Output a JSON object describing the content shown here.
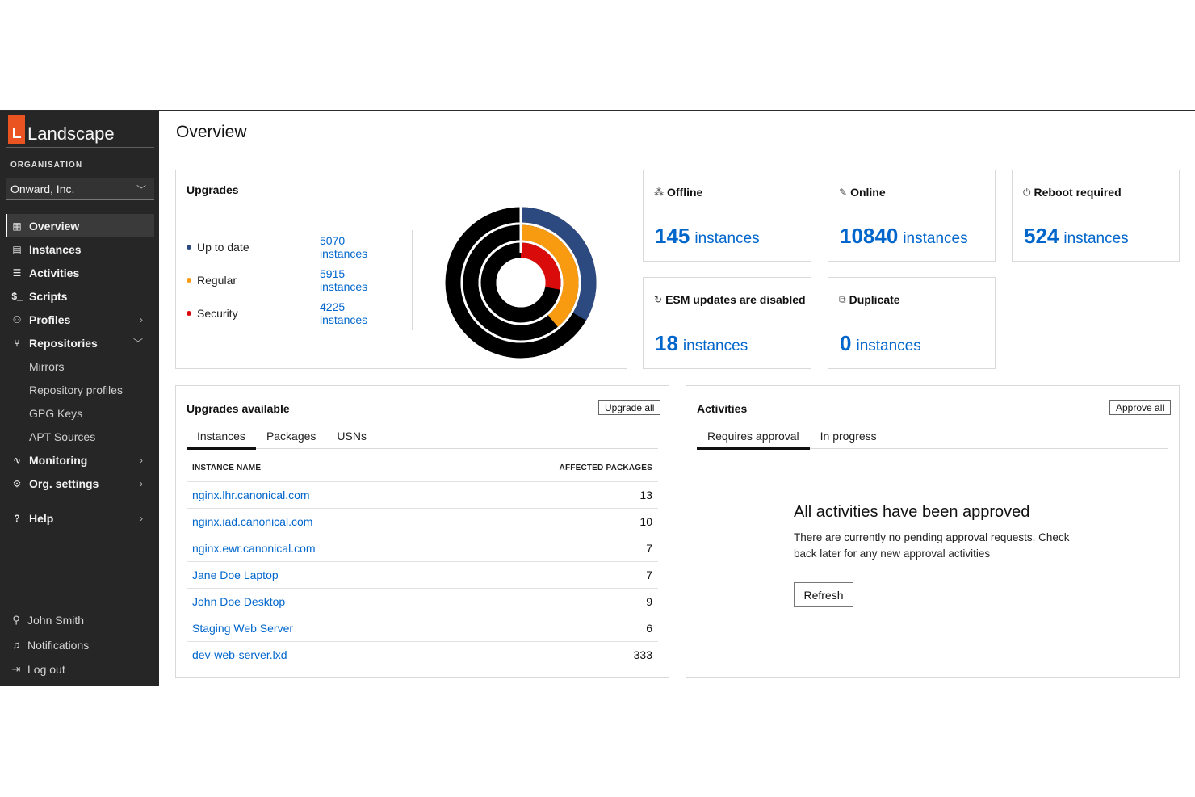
{
  "app": {
    "name": "Landscape"
  },
  "sidebar": {
    "org_label": "ORGANISATION",
    "org_value": "Onward, Inc.",
    "items": [
      {
        "label": "Overview",
        "icon": "grid-icon"
      },
      {
        "label": "Instances",
        "icon": "server-icon"
      },
      {
        "label": "Activities",
        "icon": "list-icon"
      },
      {
        "label": "Scripts",
        "icon": "terminal-icon"
      },
      {
        "label": "Profiles",
        "icon": "profiles-icon"
      },
      {
        "label": "Repositories",
        "icon": "fork-icon"
      },
      {
        "label": "Monitoring",
        "icon": "pulse-icon"
      },
      {
        "label": "Org. settings",
        "icon": "gear-icon"
      },
      {
        "label": "Help",
        "icon": "help-icon"
      }
    ],
    "repo_children": [
      "Mirrors",
      "Repository profiles",
      "GPG Keys",
      "APT Sources"
    ],
    "bottom": [
      {
        "label": "John Smith",
        "icon": "user-icon"
      },
      {
        "label": "Notifications",
        "icon": "bell-icon"
      },
      {
        "label": "Log out",
        "icon": "logout-icon"
      }
    ]
  },
  "page": {
    "title": "Overview"
  },
  "upgrades": {
    "title": "Upgrades",
    "legend": [
      {
        "label": "Up to date",
        "value": "5070 instances",
        "color": "#2c4a80"
      },
      {
        "label": "Regular",
        "value": "5915 instances",
        "color": "#f99b11"
      },
      {
        "label": "Security",
        "value": "4225 instances",
        "color": "#da0b0b"
      }
    ]
  },
  "chart_data": {
    "type": "pie",
    "rings": [
      {
        "name": "Up to date",
        "value": 5070,
        "total": 15210,
        "color": "#2c4a80"
      },
      {
        "name": "Regular",
        "value": 5915,
        "total": 15210,
        "color": "#f99b11"
      },
      {
        "name": "Security",
        "value": 4225,
        "total": 15210,
        "color": "#da0b0b"
      }
    ],
    "remainder_color": "#000000"
  },
  "stats": {
    "offline": {
      "title": "Offline",
      "number": "145",
      "unit": "instances",
      "icon": "offline-icon"
    },
    "online": {
      "title": "Online",
      "number": "10840",
      "unit": "instances",
      "icon": "online-icon"
    },
    "reboot": {
      "title": "Reboot required",
      "number": "524",
      "unit": "instances",
      "icon": "power-icon"
    },
    "esm": {
      "title": "ESM updates are disabled",
      "number": "18",
      "unit": "instances",
      "icon": "refresh-icon"
    },
    "duplicate": {
      "title": "Duplicate",
      "number": "0",
      "unit": "instances",
      "icon": "duplicate-icon"
    }
  },
  "upgrades_available": {
    "title": "Upgrades available",
    "button": "Upgrade all",
    "tabs": [
      "Instances",
      "Packages",
      "USNs"
    ],
    "columns": [
      "INSTANCE NAME",
      "AFFECTED PACKAGES"
    ],
    "rows": [
      {
        "name": "nginx.lhr.canonical.com",
        "count": "13"
      },
      {
        "name": "nginx.iad.canonical.com",
        "count": "10"
      },
      {
        "name": "nginx.ewr.canonical.com",
        "count": "7"
      },
      {
        "name": "Jane Doe Laptop",
        "count": "7"
      },
      {
        "name": "John Doe Desktop",
        "count": "9"
      },
      {
        "name": "Staging Web Server",
        "count": "6"
      },
      {
        "name": "dev-web-server.lxd",
        "count": "333"
      }
    ]
  },
  "activities": {
    "title": "Activities",
    "button": "Approve all",
    "tabs": [
      "Requires approval",
      "In progress"
    ],
    "empty_title": "All activities have been approved",
    "empty_text": "There are currently no pending approval requests. Check back later for any new approval activities",
    "refresh": "Refresh"
  }
}
